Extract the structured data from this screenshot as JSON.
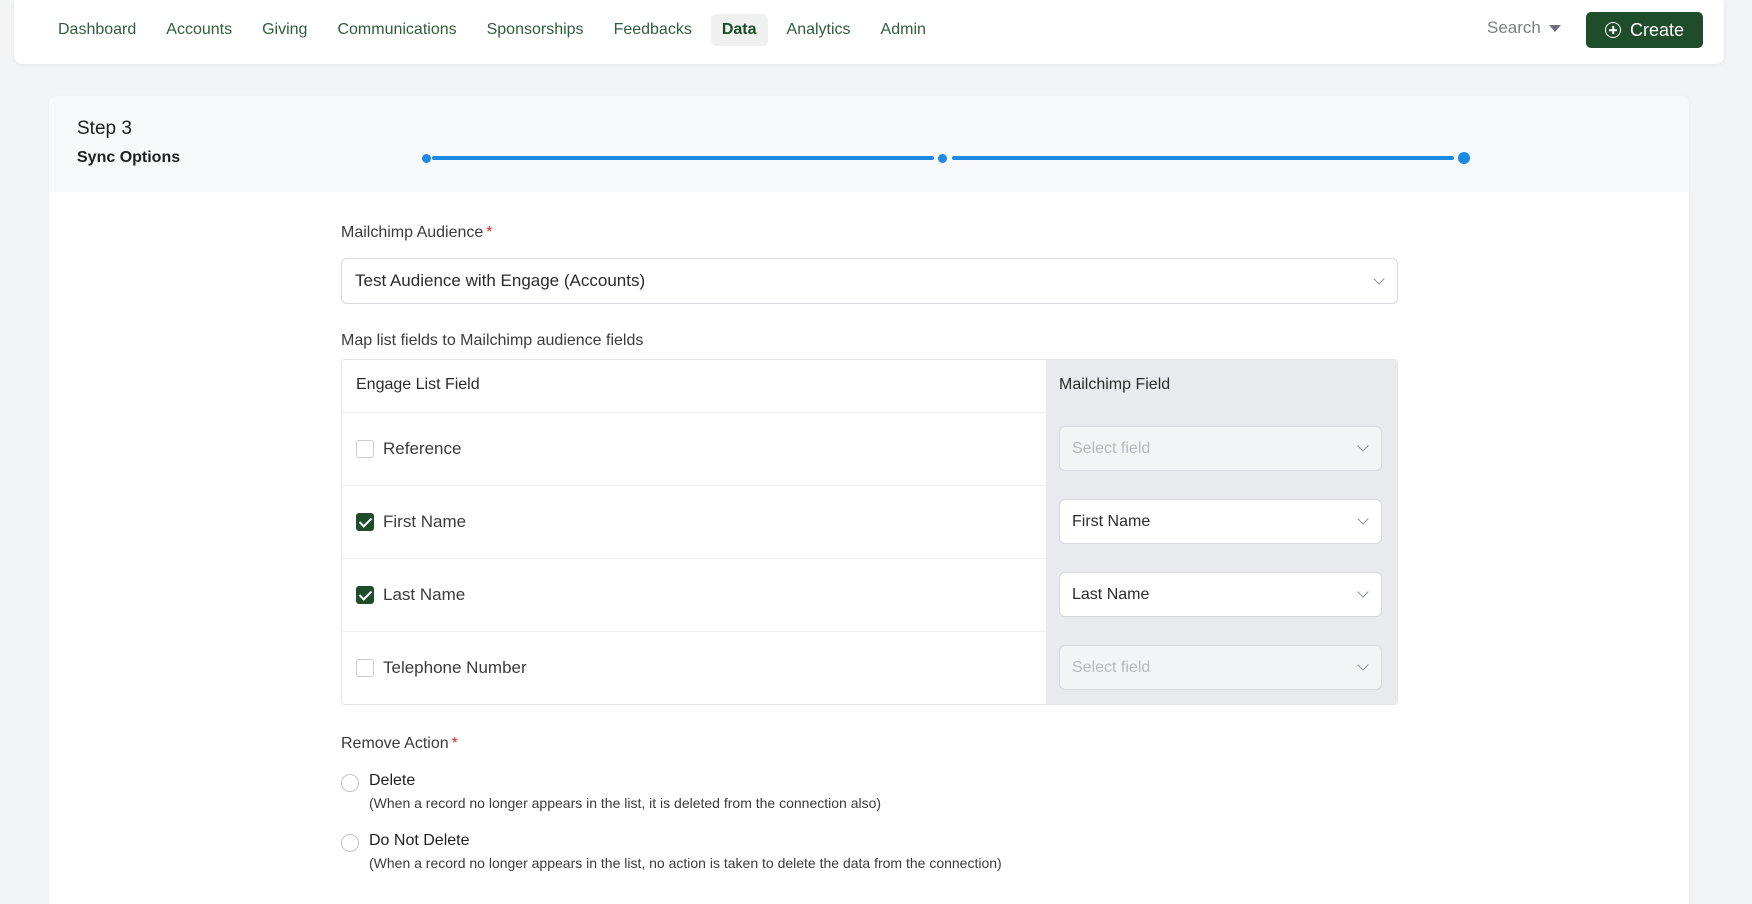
{
  "nav": {
    "items": [
      {
        "label": "Dashboard",
        "key": "dashboard"
      },
      {
        "label": "Accounts",
        "key": "accounts"
      },
      {
        "label": "Giving",
        "key": "giving"
      },
      {
        "label": "Communications",
        "key": "communications"
      },
      {
        "label": "Sponsorships",
        "key": "sponsorships"
      },
      {
        "label": "Feedbacks",
        "key": "feedbacks"
      },
      {
        "label": "Data",
        "key": "data",
        "active": true
      },
      {
        "label": "Analytics",
        "key": "analytics"
      },
      {
        "label": "Admin",
        "key": "admin"
      }
    ],
    "search_label": "Search",
    "create_label": "Create"
  },
  "step": {
    "title": "Step 3",
    "subtitle": "Sync Options",
    "current": 3,
    "total": 3
  },
  "audience": {
    "label": "Mailchimp Audience",
    "required_mark": "*",
    "value": "Test Audience with Engage (Accounts)"
  },
  "mapping": {
    "label": "Map list fields to Mailchimp audience fields",
    "col_engage": "Engage List Field",
    "col_mailchimp": "Mailchimp Field",
    "rows": [
      {
        "field": "Reference",
        "checked": false,
        "mailchimp": "Select field",
        "placeholder": true
      },
      {
        "field": "First Name",
        "checked": true,
        "mailchimp": "First Name",
        "placeholder": false
      },
      {
        "field": "Last Name",
        "checked": true,
        "mailchimp": "Last Name",
        "placeholder": false
      },
      {
        "field": "Telephone Number",
        "checked": false,
        "mailchimp": "Select field",
        "placeholder": true
      }
    ]
  },
  "remove_action": {
    "label": "Remove Action",
    "required_mark": "*",
    "options": [
      {
        "title": "Delete",
        "desc": "(When a record no longer appears in the list, it is deleted from the connection also)",
        "selected": false
      },
      {
        "title": "Do Not Delete",
        "desc": "(When a record no longer appears in the list, no action is taken to delete the data from the connection)",
        "selected": false
      }
    ]
  },
  "colors": {
    "brand_green": "#1f4d2b",
    "step_blue": "#1c8ae3",
    "required_red": "#e02424"
  }
}
